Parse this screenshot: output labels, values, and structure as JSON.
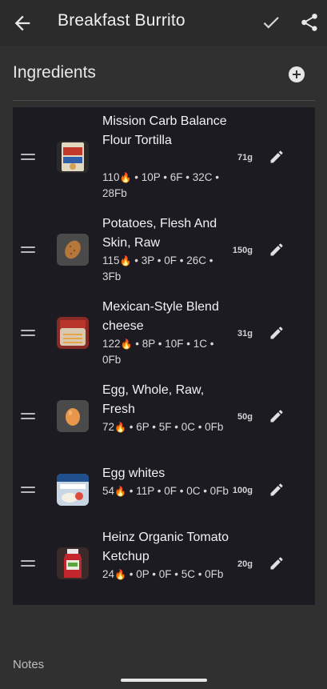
{
  "appbar": {
    "title": "Breakfast Burrito",
    "icons": [
      "arrow-back-icon",
      "check-icon",
      "share-icon"
    ]
  },
  "ingredients_section": {
    "title": "Ingredients",
    "add_icon": "add-circle-icon"
  },
  "ingredients": [
    {
      "name": "Mission Carb Balance Flour Tortilla",
      "calories": "110",
      "macros": " • 10P • 6F • 32C • 28Fb",
      "grams": "71g",
      "image": "tortilla-package"
    },
    {
      "name": "Potatoes, Flesh And Skin, Raw",
      "calories": "115",
      "macros": " • 3P • 0F • 26C • 3Fb",
      "grams": "150g",
      "image": "potato-icon"
    },
    {
      "name": "Mexican-Style Blend cheese",
      "calories": "122",
      "macros": " • 8P • 10F • 1C • 0Fb",
      "grams": "31g",
      "image": "cheese-bag"
    },
    {
      "name": "Egg, Whole, Raw, Fresh",
      "calories": "72",
      "macros": " • 6P • 5F • 0C • 0Fb",
      "grams": "50g",
      "image": "egg-icon"
    },
    {
      "name": "Egg whites",
      "calories": "54",
      "macros": " • 11P • 0F • 0C • 0Fb",
      "grams": "100g",
      "image": "egg-whites-carton"
    },
    {
      "name": "Heinz Organic Tomato Ketchup",
      "calories": "24",
      "macros": " • 0P • 0F • 5C • 0Fb",
      "grams": "20g",
      "image": "ketchup-bottle"
    }
  ],
  "notes": {
    "label": "Notes"
  },
  "colors": {
    "background": "#303030",
    "list_background": "#1c1b21",
    "text": "#f2f2f2"
  }
}
